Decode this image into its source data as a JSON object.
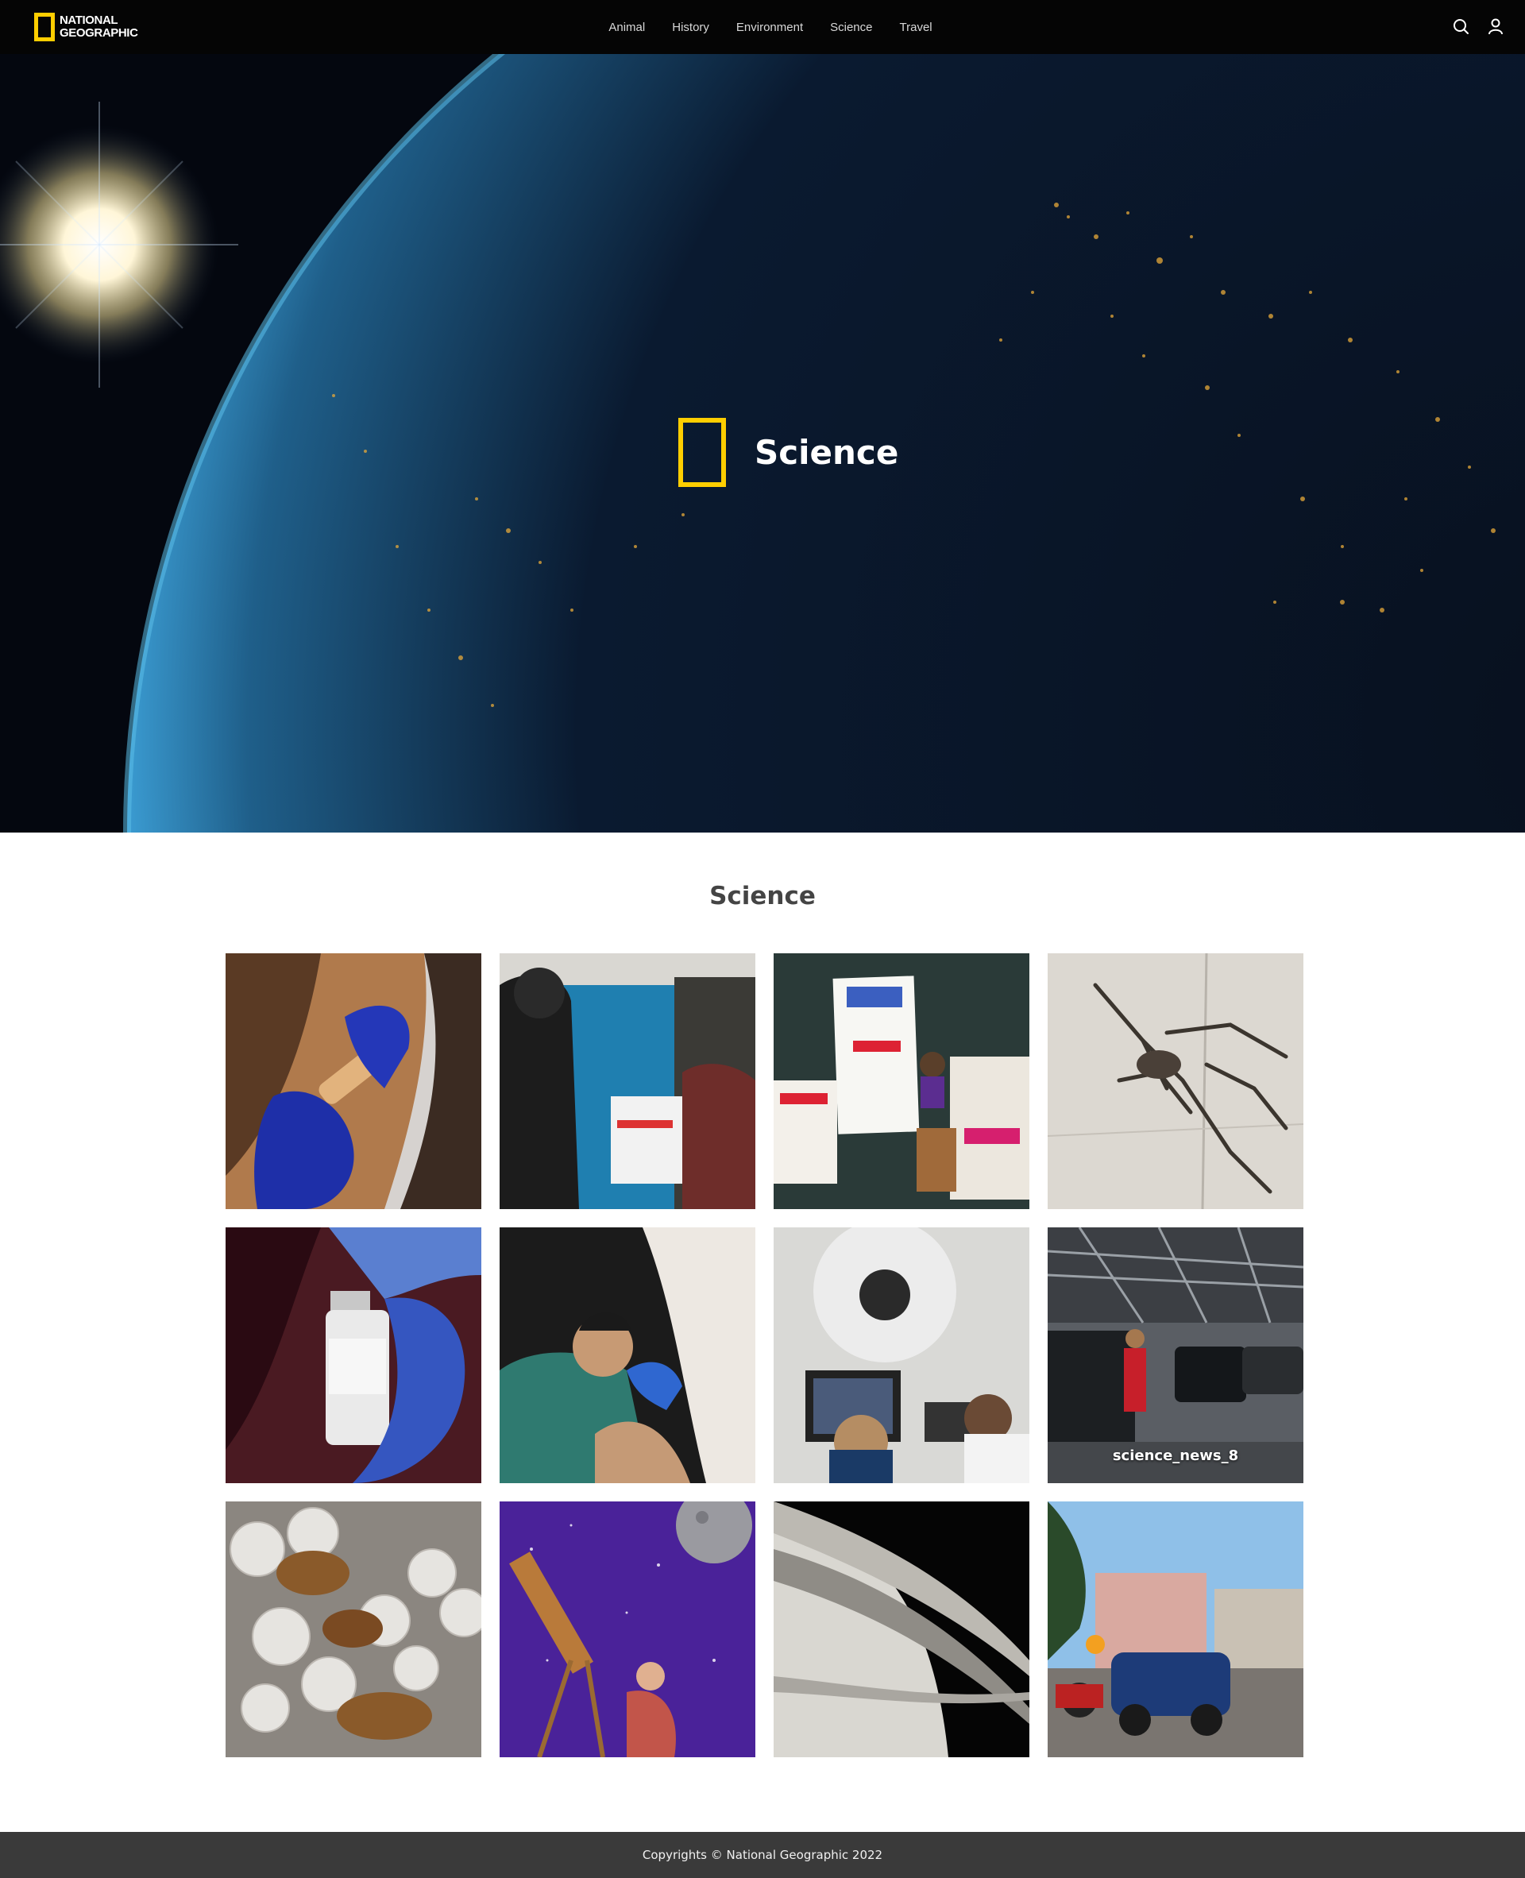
{
  "header": {
    "logo_line1": "NATIONAL",
    "logo_line2": "GEOGRAPHIC",
    "nav": [
      "Animal",
      "History",
      "Environment",
      "Science",
      "Travel"
    ],
    "icons": [
      "search-icon",
      "user-icon"
    ]
  },
  "hero": {
    "title": "Science"
  },
  "section": {
    "title": "Science",
    "tiles": [
      {
        "caption": ""
      },
      {
        "caption": ""
      },
      {
        "caption": ""
      },
      {
        "caption": ""
      },
      {
        "caption": ""
      },
      {
        "caption": ""
      },
      {
        "caption": ""
      },
      {
        "caption": "science_news_8"
      },
      {
        "caption": ""
      },
      {
        "caption": ""
      },
      {
        "caption": ""
      },
      {
        "caption": ""
      }
    ]
  },
  "footer": {
    "copyright": "Copyrights © National Geographic 2022"
  },
  "colors": {
    "brand_yellow": "#ffce00",
    "header_bg": "#050505",
    "footer_bg": "#3a3a3a"
  }
}
